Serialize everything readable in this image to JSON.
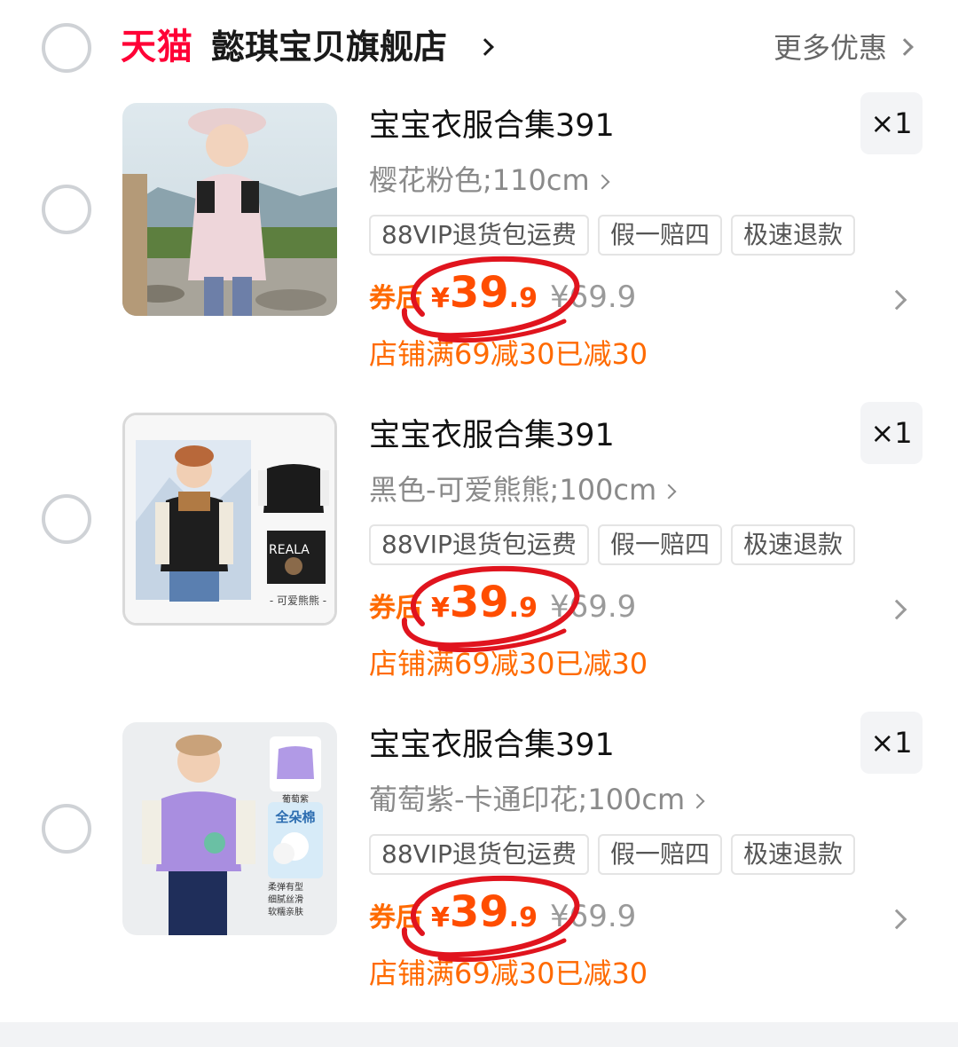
{
  "shop": {
    "logo_text": "天猫",
    "name": "懿琪宝贝旗舰店",
    "more_offers": "更多优惠"
  },
  "items": [
    {
      "title": "宝宝衣服合集391",
      "variant": "樱花粉色;110cm",
      "quantity": "×1",
      "tags": [
        "88VIP退货包运费",
        "假一赔四",
        "极速退款"
      ],
      "coupon_label": "券后",
      "currency": "¥",
      "price_int": "39",
      "price_dec": ".9",
      "original_price": "¥69.9",
      "discount_note": "店铺满69减30已减30",
      "image_desc": "girl-pink-jacket"
    },
    {
      "title": "宝宝衣服合集391",
      "variant": "黑色-可爱熊熊;100cm",
      "quantity": "×1",
      "tags": [
        "88VIP退货包运费",
        "假一赔四",
        "极速退款"
      ],
      "coupon_label": "券后",
      "currency": "¥",
      "price_int": "39",
      "price_dec": ".9",
      "original_price": "¥69.9",
      "discount_note": "店铺满69减30已减30",
      "image_caption": "- 可爱熊熊 -"
    },
    {
      "title": "宝宝衣服合集391",
      "variant": "葡萄紫-卡通印花;100cm",
      "quantity": "×1",
      "tags": [
        "88VIP退货包运费",
        "假一赔四",
        "极速退款"
      ],
      "coupon_label": "券后",
      "currency": "¥",
      "price_int": "39",
      "price_dec": ".9",
      "original_price": "¥69.9",
      "discount_note": "店铺满69减30已减30",
      "image_caption": "葡萄紫",
      "image_badge": "全朵棉",
      "image_features": [
        "柔弹有型",
        "细腻丝滑",
        "软糯亲肤"
      ]
    }
  ],
  "colors": {
    "tmall_red": "#ff0036",
    "price_orange": "#ff4d00",
    "promo_orange": "#ff6a00",
    "annotation_red": "#e0141e"
  }
}
